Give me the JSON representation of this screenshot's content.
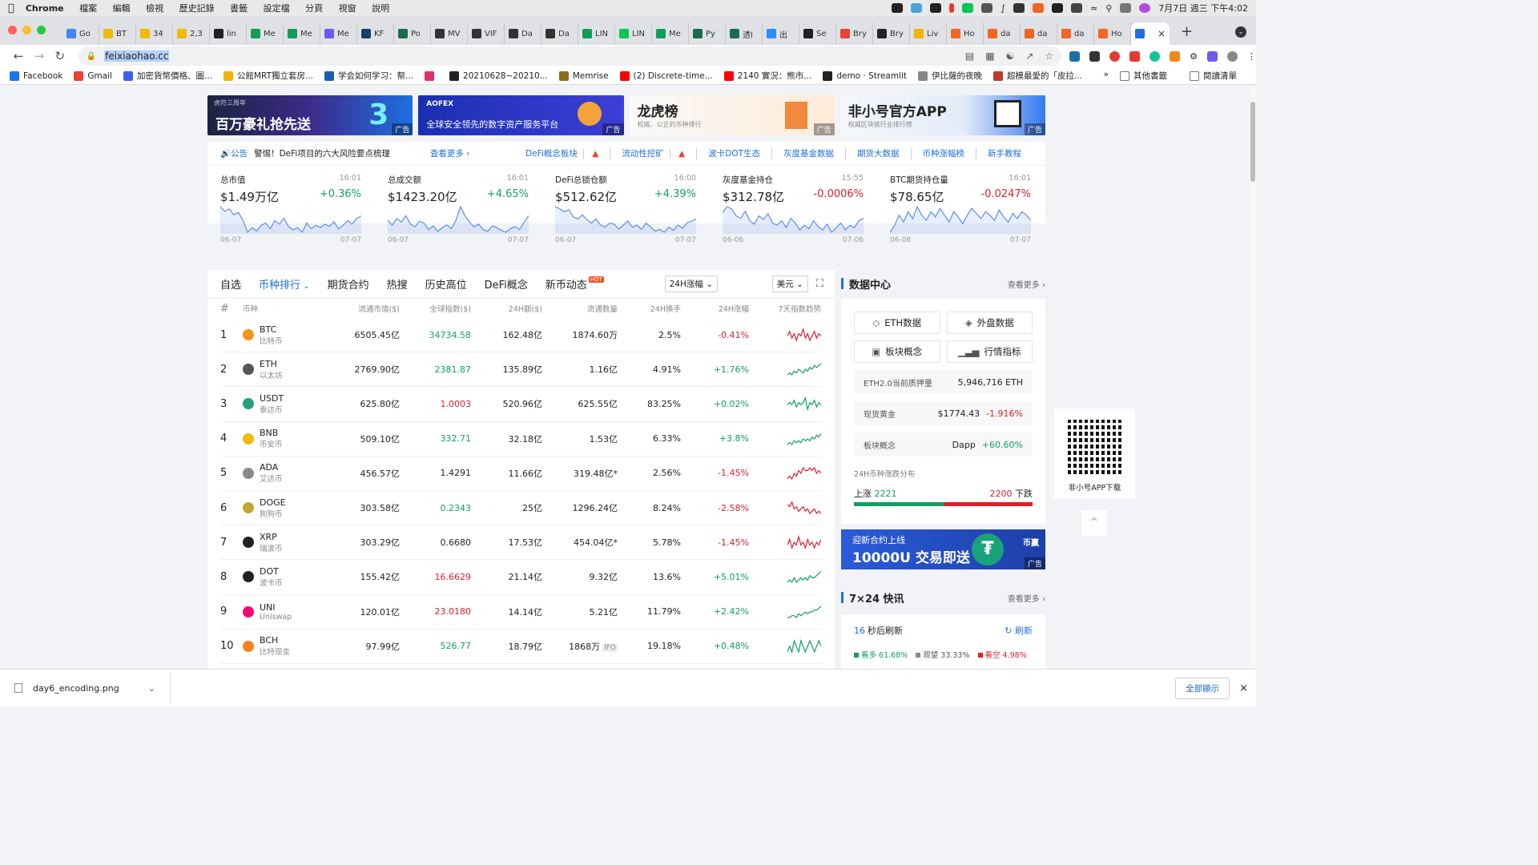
{
  "macos": {
    "app_name": "Chrome",
    "menus": [
      "檔案",
      "編輯",
      "檢視",
      "歷史記錄",
      "書籤",
      "設定檔",
      "分頁",
      "視窗",
      "說明"
    ],
    "clock": "7月7日 週三 下午4:02"
  },
  "tabs": [
    {
      "label": "Go",
      "color": "#4285f4"
    },
    {
      "label": "BT",
      "color": "#f0b90b"
    },
    {
      "label": "34",
      "color": "#f0b90b"
    },
    {
      "label": "2,3",
      "color": "#f0b90b"
    },
    {
      "label": "lin",
      "color": "#222222"
    },
    {
      "label": "Me",
      "color": "#0f9d58"
    },
    {
      "label": "Me",
      "color": "#0f9d58"
    },
    {
      "label": "Me",
      "color": "#6a5cf0"
    },
    {
      "label": "KF",
      "color": "#1c3c6e"
    },
    {
      "label": "Po",
      "color": "#1a6b4e"
    },
    {
      "label": "MV",
      "color": "#333333"
    },
    {
      "label": "VIF",
      "color": "#333333"
    },
    {
      "label": "Da",
      "color": "#333333"
    },
    {
      "label": "Da",
      "color": "#333333"
    },
    {
      "label": "LIN",
      "color": "#0f9d58"
    },
    {
      "label": "LIN",
      "color": "#06c755"
    },
    {
      "label": "Me",
      "color": "#0f9d58"
    },
    {
      "label": "Py",
      "color": "#1a6b4e"
    },
    {
      "label": "透l",
      "color": "#1a6b4e"
    },
    {
      "label": "出",
      "color": "#2d8cff"
    },
    {
      "label": "Se",
      "color": "#222222"
    },
    {
      "label": "Bry",
      "color": "#ea4335"
    },
    {
      "label": "Bry",
      "color": "#222222"
    },
    {
      "label": "Liv",
      "color": "#f4b400"
    },
    {
      "label": "Ho",
      "color": "#f26522"
    },
    {
      "label": "da",
      "color": "#f26522"
    },
    {
      "label": "da",
      "color": "#f26522"
    },
    {
      "label": "da",
      "color": "#f26522"
    },
    {
      "label": "Ho",
      "color": "#f26522"
    }
  ],
  "omnibox": {
    "url": "feixiaohao.cc"
  },
  "bookmarks": [
    {
      "label": "Facebook",
      "color": "#1877f2"
    },
    {
      "label": "Gmail",
      "color": "#ea4335"
    },
    {
      "label": "加密貨幣價格、圖...",
      "color": "#3861fb"
    },
    {
      "label": "公館MRT獨立套房...",
      "color": "#f4b400"
    },
    {
      "label": "学会如何学习：帮...",
      "color": "#1a5fb4"
    },
    {
      "label": "",
      "color": "#e1306c"
    },
    {
      "label": "20210628~20210...",
      "color": "#222222"
    },
    {
      "label": "Memrise",
      "color": "#8a6d1e"
    },
    {
      "label": "(2) Discrete-time...",
      "color": "#ff0000"
    },
    {
      "label": "2140 實況：熊市...",
      "color": "#ff0000"
    },
    {
      "label": "demo · Streamlit",
      "color": "#222222"
    },
    {
      "label": "伊比薩的夜晚",
      "color": "#888888"
    },
    {
      "label": "超模最愛的「皮拉...",
      "color": "#c0392b"
    }
  ],
  "bookmarks_right": [
    "其他書籤",
    "閱讀清單"
  ],
  "banners": [
    {
      "title": "百万豪礼抢先送",
      "small": "虎符三周年",
      "ad": "广告"
    },
    {
      "brand": "AOFEX",
      "text": "全球安全领先的数字资产服务平台",
      "ad": "广告"
    },
    {
      "title": "龙虎榜",
      "sub": "权威、公正的币种排行",
      "ad": "广告"
    },
    {
      "title": "非小号官方APP",
      "sub": "权威区块链行业排行榜",
      "ad": "广告"
    }
  ],
  "notice": {
    "tag": "公告",
    "text": "警惕！DeFi项目的六大风险要点梳理",
    "more": "查看更多",
    "links": [
      {
        "label": "DeFi概念板块",
        "fire": true
      },
      {
        "label": "流动性挖矿",
        "fire": true
      },
      {
        "label": "波卡DOT生态",
        "fire": false
      },
      {
        "label": "灰度基金数据",
        "fire": false
      },
      {
        "label": "期货大数据",
        "fire": false
      },
      {
        "label": "币种涨幅榜",
        "fire": false
      },
      {
        "label": "新手教程",
        "fire": false
      }
    ]
  },
  "metrics": [
    {
      "label": "总市值",
      "time": "16:01",
      "value": "$1.49万亿",
      "change": "+0.36%",
      "trend": "up",
      "start": "06-07",
      "end": "07-07",
      "series": [
        62,
        58,
        60,
        55,
        57,
        50,
        40,
        44,
        41,
        46,
        48,
        43,
        50,
        47,
        52,
        45,
        42,
        44,
        40,
        48,
        43,
        46,
        44,
        47,
        45,
        49,
        43,
        46,
        50,
        47,
        52,
        54
      ]
    },
    {
      "label": "总成交额",
      "time": "16:01",
      "value": "$1423.20亿",
      "change": "+4.65%",
      "trend": "up",
      "start": "06-07",
      "end": "07-07",
      "series": [
        40,
        35,
        42,
        38,
        45,
        36,
        33,
        39,
        37,
        30,
        34,
        28,
        32,
        35,
        31,
        40,
        55,
        45,
        38,
        33,
        36,
        30,
        28,
        34,
        32,
        29,
        27,
        31,
        33,
        30,
        38,
        45
      ]
    },
    {
      "label": "DeFi总锁仓额",
      "time": "16:00",
      "value": "$512.62亿",
      "change": "+4.39%",
      "trend": "up",
      "start": "06-07",
      "end": "07-07",
      "series": [
        60,
        58,
        55,
        57,
        50,
        48,
        52,
        47,
        44,
        48,
        42,
        40,
        44,
        43,
        38,
        42,
        46,
        40,
        42,
        38,
        44,
        40,
        36,
        38,
        35,
        40,
        37,
        42,
        39,
        44,
        46,
        48
      ]
    },
    {
      "label": "灰度基金持仓",
      "time": "15:55",
      "value": "$312.78亿",
      "change": "-0.0006%",
      "trend": "down",
      "start": "06-06",
      "end": "07-06",
      "series": [
        55,
        60,
        58,
        52,
        50,
        56,
        48,
        45,
        52,
        49,
        54,
        46,
        44,
        48,
        42,
        50,
        46,
        40,
        44,
        41,
        48,
        43,
        40,
        45,
        38,
        42,
        46,
        40,
        44,
        42,
        48,
        50
      ]
    },
    {
      "label": "BTC期货持仓量",
      "time": "16:01",
      "value": "$78.65亿",
      "change": "-0.0247%",
      "trend": "down",
      "start": "06-08",
      "end": "07-07",
      "series": [
        40,
        44,
        50,
        46,
        52,
        48,
        55,
        50,
        47,
        52,
        49,
        54,
        50,
        46,
        52,
        49,
        45,
        50,
        54,
        51,
        48,
        52,
        50,
        47,
        53,
        49,
        46,
        51,
        48,
        52,
        50,
        47
      ]
    }
  ],
  "coin_tabs": [
    "自选",
    "币种排行",
    "期货合约",
    "热搜",
    "历史高位",
    "DeFi概念",
    "新币动态"
  ],
  "coin_tabs_active": 1,
  "hot_badge": "HOT",
  "sort_select": "24H涨幅",
  "currency_select": "美元",
  "table": {
    "headers": [
      "#",
      "币种",
      "流通市值($)",
      "全球指数($)",
      "24H额($)",
      "流通数量",
      "24H换手",
      "24H涨幅",
      "7天指数趋势"
    ],
    "rows": [
      {
        "rank": "1",
        "symbol": "BTC",
        "name": "比特币",
        "cap": "6505.45亿",
        "index": "34734.58",
        "index_color": "up",
        "vol": "162.48亿",
        "supply": "1874.60万",
        "supply_tag": "",
        "turnover": "2.5%",
        "change": "-0.41%",
        "trend": "down",
        "icon_color": "#f7931a",
        "spark": [
          5,
          7,
          4,
          6,
          3,
          6,
          5,
          8,
          4,
          6,
          3,
          5,
          7,
          4,
          6,
          5
        ]
      },
      {
        "rank": "2",
        "symbol": "ETH",
        "name": "以太坊",
        "cap": "2769.90亿",
        "index": "2381.87",
        "index_color": "up",
        "vol": "135.89亿",
        "supply": "1.16亿",
        "supply_tag": "",
        "turnover": "4.91%",
        "change": "+1.76%",
        "trend": "up",
        "icon_color": "#555555",
        "spark": [
          3,
          4,
          3,
          5,
          4,
          6,
          5,
          4,
          6,
          5,
          7,
          6,
          8,
          7,
          8,
          9
        ]
      },
      {
        "rank": "3",
        "symbol": "USDT",
        "name": "泰达币",
        "cap": "625.80亿",
        "index": "1.0003",
        "index_color": "down",
        "vol": "520.96亿",
        "supply": "625.55亿",
        "supply_tag": "",
        "turnover": "83.25%",
        "change": "+0.02%",
        "trend": "up",
        "icon_color": "#26a17b",
        "spark": [
          5,
          6,
          5,
          7,
          4,
          6,
          5,
          6,
          8,
          3,
          6,
          5,
          7,
          4,
          6,
          5
        ]
      },
      {
        "rank": "4",
        "symbol": "BNB",
        "name": "币安币",
        "cap": "509.10亿",
        "index": "332.71",
        "index_color": "up",
        "vol": "32.18亿",
        "supply": "1.53亿",
        "supply_tag": "",
        "turnover": "6.33%",
        "change": "+3.8%",
        "trend": "up",
        "icon_color": "#f0b90b",
        "spark": [
          3,
          4,
          3,
          5,
          4,
          5,
          4,
          6,
          5,
          6,
          5,
          7,
          6,
          8,
          7,
          9
        ]
      },
      {
        "rank": "5",
        "symbol": "ADA",
        "name": "艾达币",
        "cap": "456.57亿",
        "index": "1.4291",
        "index_color": "neutral",
        "vol": "11.66亿",
        "supply": "319.48亿*",
        "supply_tag": "",
        "turnover": "2.56%",
        "change": "-1.45%",
        "trend": "down",
        "icon_color": "#8a8a8a",
        "spark": [
          4,
          5,
          4,
          6,
          5,
          7,
          6,
          8,
          7,
          7,
          8,
          7,
          8,
          6,
          7,
          6
        ]
      },
      {
        "rank": "6",
        "symbol": "DOGE",
        "name": "狗狗币",
        "cap": "303.58亿",
        "index": "0.2343",
        "index_color": "up",
        "vol": "25亿",
        "supply": "1296.24亿",
        "supply_tag": "",
        "turnover": "8.24%",
        "change": "-2.58%",
        "trend": "down",
        "icon_color": "#c2a633",
        "spark": [
          8,
          7,
          9,
          6,
          7,
          5,
          6,
          7,
          5,
          6,
          4,
          5,
          6,
          4,
          5,
          4
        ]
      },
      {
        "rank": "7",
        "symbol": "XRP",
        "name": "瑞波币",
        "cap": "303.29亿",
        "index": "0.6680",
        "index_color": "neutral",
        "vol": "17.53亿",
        "supply": "454.04亿*",
        "supply_tag": "",
        "turnover": "5.78%",
        "change": "-1.45%",
        "trend": "down",
        "icon_color": "#222222",
        "spark": [
          5,
          7,
          4,
          6,
          5,
          8,
          5,
          6,
          4,
          7,
          5,
          6,
          4,
          6,
          5,
          7
        ]
      },
      {
        "rank": "8",
        "symbol": "DOT",
        "name": "波卡币",
        "cap": "155.42亿",
        "index": "16.6629",
        "index_color": "down",
        "vol": "21.14亿",
        "supply": "9.32亿",
        "supply_tag": "",
        "turnover": "13.6%",
        "change": "+5.01%",
        "trend": "up",
        "icon_color": "#222222",
        "spark": [
          4,
          5,
          4,
          6,
          4,
          5,
          6,
          5,
          6,
          5,
          7,
          6,
          6,
          7,
          8,
          9
        ]
      },
      {
        "rank": "9",
        "symbol": "UNI",
        "name": "Uniswap",
        "cap": "120.01亿",
        "index": "23.0180",
        "index_color": "down",
        "vol": "14.14亿",
        "supply": "5.21亿",
        "supply_tag": "",
        "turnover": "11.79%",
        "change": "+2.42%",
        "trend": "up",
        "icon_color": "#ff007a",
        "spark": [
          3,
          3,
          4,
          4,
          3,
          5,
          4,
          5,
          6,
          5,
          6,
          6,
          7,
          7,
          8,
          9
        ]
      },
      {
        "rank": "10",
        "symbol": "BCH",
        "name": "比特现金",
        "cap": "97.99亿",
        "index": "526.77",
        "index_color": "up",
        "vol": "18.79亿",
        "supply": "1868万",
        "supply_tag": "IFO",
        "turnover": "19.18%",
        "change": "+0.48%",
        "trend": "up",
        "icon_color": "#f58220",
        "spark": [
          5,
          6,
          5,
          7,
          6,
          5,
          7,
          6,
          5,
          6,
          7,
          6,
          5,
          6,
          7,
          6
        ]
      }
    ]
  },
  "datacenter": {
    "title": "数据中心",
    "more": "查看更多",
    "buttons": [
      "ETH数据",
      "外盘数据",
      "板块概念",
      "行情指标"
    ],
    "eth2_label": "ETH2.0当前质押量",
    "eth2_value": "5,946,716 ETH",
    "gold_label": "现货黄金",
    "gold_value": "$1774.43",
    "gold_change": "-1.916%",
    "sector_label": "板块概念",
    "sector_value": "Dapp",
    "sector_change": "+60.60%",
    "dist_title": "24H币种涨跌分布",
    "up_label": "上涨",
    "up_count": "2221",
    "down_count": "2200",
    "down_label": "下跌",
    "up_fraction": 0.5024
  },
  "side_ad": {
    "line1": "迎新合约上线",
    "line2": "10000U 交易即送",
    "brand": "币赢",
    "ad": "广告"
  },
  "news": {
    "title": "7×24 快讯",
    "more": "查看更多",
    "seconds": "16",
    "refresh_text": "秒后刷新",
    "refresh": "刷新",
    "bull": "看多 61.68%",
    "neutral": "观望 33.33%",
    "bear": "看空 4.98%"
  },
  "qr": {
    "label": "非小号APP下载"
  },
  "download": {
    "file": "day6_encoding.png",
    "show_all": "全部顯示"
  },
  "colors": {
    "up": "#10a063",
    "down": "#e21d2a",
    "accent": "#1f6fe0"
  }
}
